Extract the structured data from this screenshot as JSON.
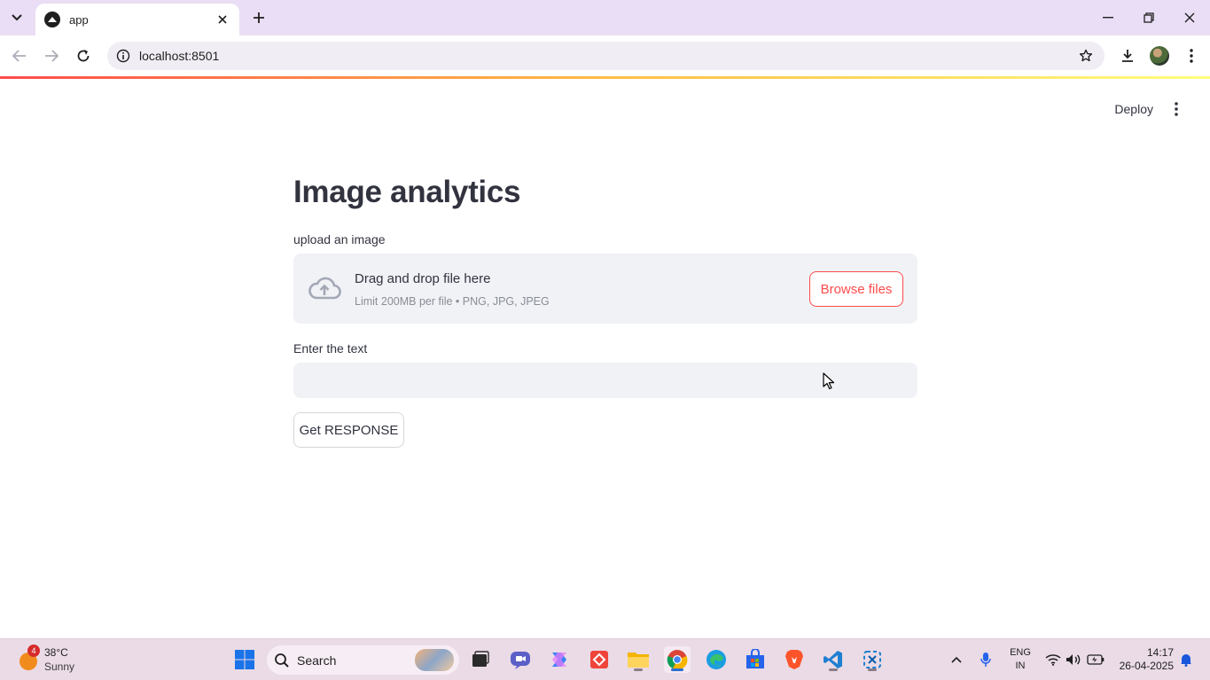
{
  "browser": {
    "tab_title": "app",
    "url": "localhost:8501"
  },
  "app": {
    "deploy_label": "Deploy",
    "title": "Image analytics",
    "upload_label": "upload an image",
    "dropzone_main": "Drag and drop file here",
    "dropzone_sub": "Limit 200MB per file • PNG, JPG, JPEG",
    "browse_label": "Browse files",
    "text_label": "Enter the text",
    "text_value": "",
    "button_label": "Get RESPONSE"
  },
  "taskbar": {
    "weather_badge": "4",
    "weather_temp": "38°C",
    "weather_desc": "Sunny",
    "search_label": "Search",
    "lang_line1": "ENG",
    "lang_line2": "IN",
    "time": "14:17",
    "date": "26-04-2025"
  },
  "colors": {
    "accent": "#ff4b4b",
    "tabstrip": "#e9def6",
    "taskbar": "#eadbe6"
  }
}
